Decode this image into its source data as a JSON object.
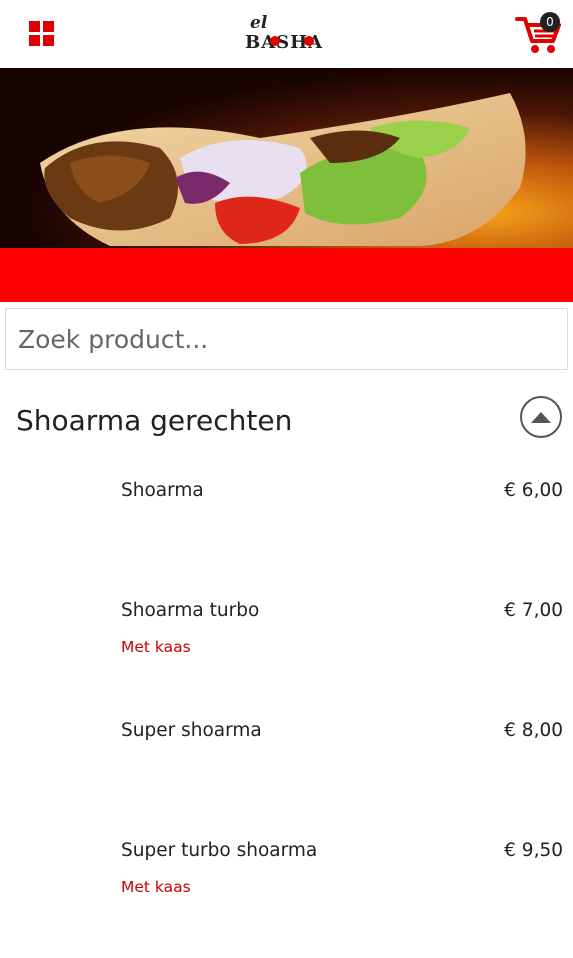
{
  "header": {
    "logo_text_top": "el",
    "logo_text_main": "BASHA",
    "cart_count": "0"
  },
  "search": {
    "placeholder": "Zoek product..."
  },
  "category": {
    "title": "Shoarma gerechten"
  },
  "products": [
    {
      "name": "Shoarma",
      "price": "€ 6,00",
      "note": ""
    },
    {
      "name": "Shoarma turbo",
      "price": "€ 7,00",
      "note": "Met kaas"
    },
    {
      "name": "Super shoarma",
      "price": "€ 8,00",
      "note": ""
    },
    {
      "name": "Super turbo shoarma",
      "price": "€ 9,50",
      "note": "Met kaas"
    }
  ],
  "colors": {
    "accent": "#ff0000",
    "note": "#d00000"
  },
  "icons": {
    "menu": "grid-icon",
    "cart": "cart-icon",
    "collapse": "chevron-up-circle-icon"
  }
}
